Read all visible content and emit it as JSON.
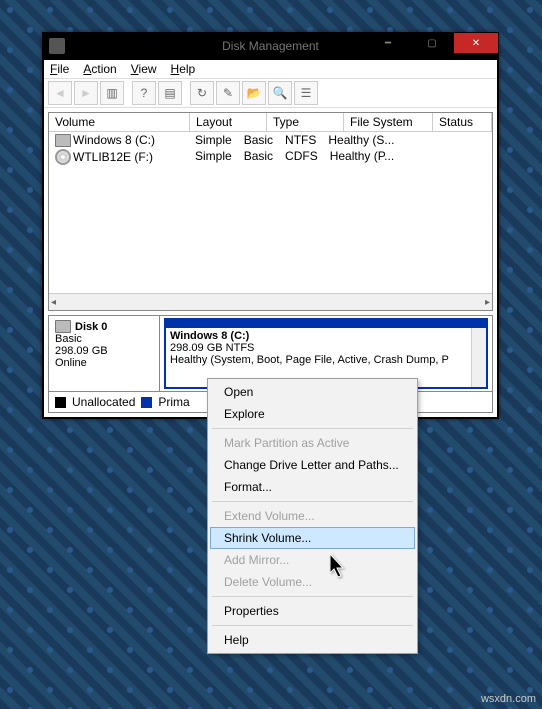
{
  "window": {
    "title": "Disk Management",
    "buttons": {
      "min": "━",
      "max": "▢",
      "close": "✕"
    }
  },
  "menubar": [
    "File",
    "Action",
    "View",
    "Help"
  ],
  "toolbar_icons": [
    "back",
    "forward",
    "up",
    "|",
    "props",
    "help",
    "|",
    "refresh",
    "export",
    "open",
    "find",
    "list"
  ],
  "columns": [
    "Volume",
    "Layout",
    "Type",
    "File System",
    "Status"
  ],
  "volumes": [
    {
      "icon": "drive",
      "name": "Windows 8 (C:)",
      "layout": "Simple",
      "type": "Basic",
      "fs": "NTFS",
      "status": "Healthy (S..."
    },
    {
      "icon": "cd",
      "name": "WTLIB12E (F:)",
      "layout": "Simple",
      "type": "Basic",
      "fs": "CDFS",
      "status": "Healthy (P..."
    }
  ],
  "disk": {
    "label": "Disk 0",
    "kind": "Basic",
    "size": "298.09 GB",
    "state": "Online",
    "partition": {
      "title": "Windows 8  (C:)",
      "subtitle": "298.09 GB NTFS",
      "status": "Healthy (System, Boot, Page File, Active, Crash Dump, P"
    }
  },
  "legend": {
    "unallocated": "Unallocated",
    "primary": "Prima"
  },
  "contextmenu": [
    {
      "label": "Open",
      "enabled": true
    },
    {
      "label": "Explore",
      "enabled": true
    },
    {
      "sep": true
    },
    {
      "label": "Mark Partition as Active",
      "enabled": false
    },
    {
      "label": "Change Drive Letter and Paths...",
      "enabled": true
    },
    {
      "label": "Format...",
      "enabled": true
    },
    {
      "sep": true
    },
    {
      "label": "Extend Volume...",
      "enabled": false
    },
    {
      "label": "Shrink Volume...",
      "enabled": true,
      "highlight": true
    },
    {
      "label": "Add Mirror...",
      "enabled": false
    },
    {
      "label": "Delete Volume...",
      "enabled": false
    },
    {
      "sep": true
    },
    {
      "label": "Properties",
      "enabled": true
    },
    {
      "sep": true
    },
    {
      "label": "Help",
      "enabled": true
    }
  ],
  "watermark": "wsxdn.com"
}
